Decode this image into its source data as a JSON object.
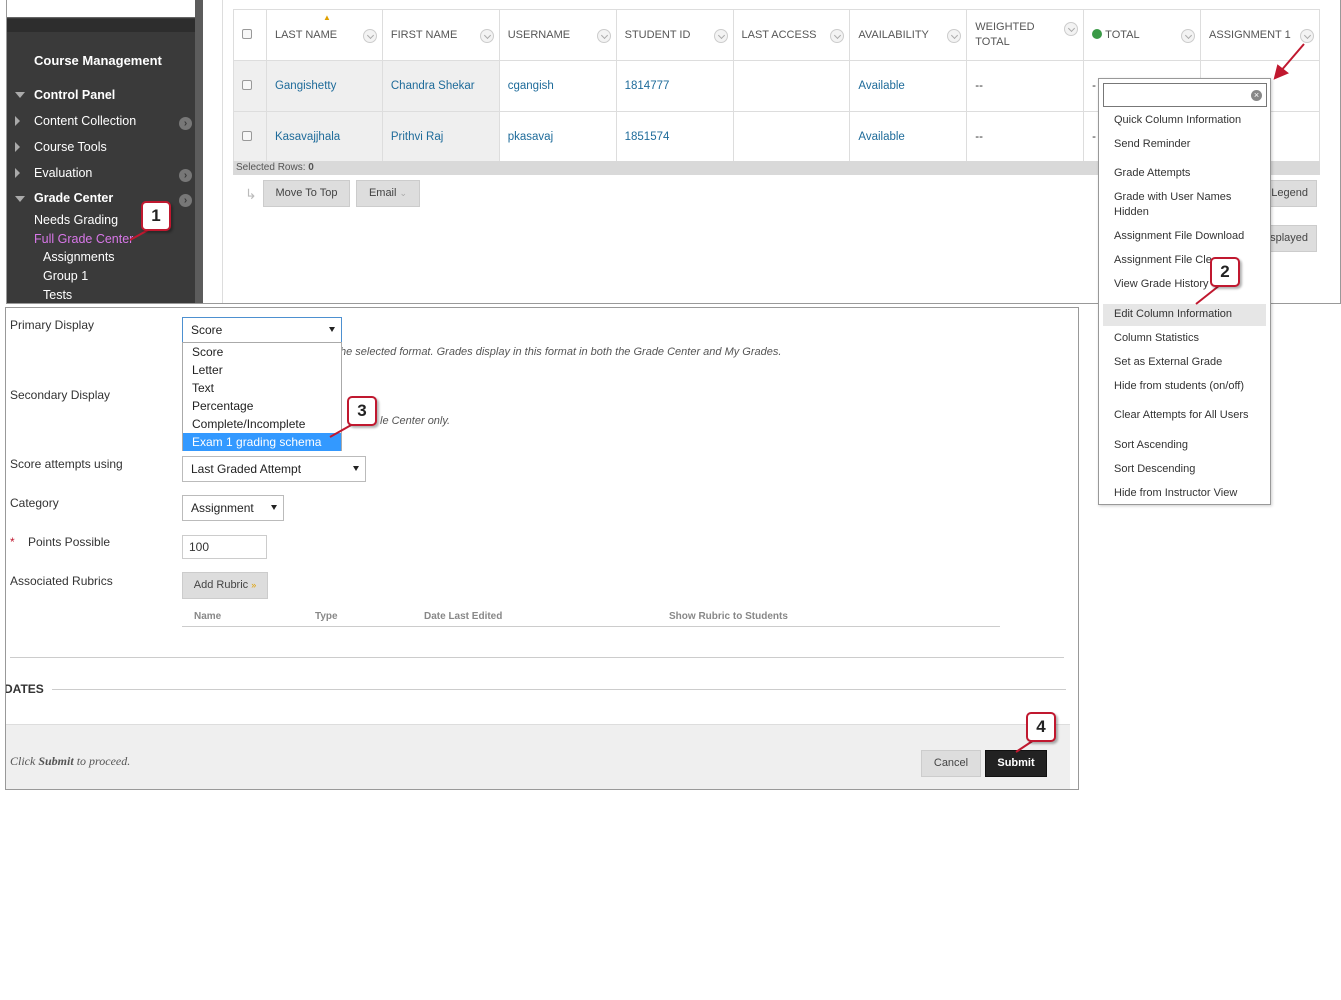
{
  "sidebar": {
    "title": "Course Management",
    "control_panel": "Control Panel",
    "items": [
      "Content Collection",
      "Course Tools",
      "Evaluation"
    ],
    "grade_center": "Grade Center",
    "needs_grading": "Needs Grading",
    "full_grade_center": "Full Grade Center",
    "subitems": [
      "Assignments",
      "Group 1",
      "Tests"
    ]
  },
  "grid": {
    "columns": [
      "LAST NAME",
      "FIRST NAME",
      "USERNAME",
      "STUDENT ID",
      "LAST ACCESS",
      "AVAILABILITY",
      "WEIGHTED TOTAL",
      "TOTAL",
      "ASSIGNMENT 1"
    ],
    "rows": [
      {
        "last": "Gangishetty",
        "first": "Chandra Shekar",
        "username": "cgangish",
        "id": "1814777",
        "access": "",
        "availability": "Available",
        "weighted": "--",
        "total": "-"
      },
      {
        "last": "Kasavajjhala",
        "first": "Prithvi Raj",
        "username": "pkasavaj",
        "id": "1851574",
        "access": "",
        "availability": "Available",
        "weighted": "--",
        "total": "-"
      }
    ],
    "selected_rows_label": "Selected Rows:",
    "selected_rows_count": "0",
    "move_to_top": "Move To Top",
    "email": "Email",
    "legend_partial": "Legend",
    "displayed_partial": "splayed"
  },
  "context_menu": {
    "items": [
      "Quick Column Information",
      "Send Reminder",
      "Grade Attempts",
      "Grade with User Names",
      "Hidden",
      "Assignment File Download",
      "Assignment File Cle",
      "View Grade History",
      "Edit Column Information",
      "Column Statistics",
      "Set as External Grade",
      "Hide from students (on/off)",
      "Clear Attempts for All Users",
      "Sort Ascending",
      "Sort Descending",
      "Hide from Instructor View"
    ]
  },
  "form": {
    "primary_display_label": "Primary Display",
    "primary_display_value": "Score",
    "primary_help": "he selected format. Grades display in this format in both the Grade Center and My Grades.",
    "options": [
      "Score",
      "Letter",
      "Text",
      "Percentage",
      "Complete/Incomplete",
      "Exam 1 grading schema"
    ],
    "secondary_display_label": "Secondary Display",
    "secondary_help": "le Center only.",
    "score_attempts_label": "Score attempts using",
    "score_attempts_value": "Last Graded Attempt",
    "category_label": "Category",
    "category_value": "Assignment",
    "points_label": "Points Possible",
    "points_required": "*",
    "points_value": "100",
    "rubrics_label": "Associated Rubrics",
    "add_rubric": "Add Rubric",
    "rubric_headers": [
      "Name",
      "Type",
      "Date Last Edited",
      "Show Rubric to Students"
    ],
    "dates_heading": "DATES",
    "footer_pre": "Click ",
    "footer_bold": "Submit",
    "footer_post": " to proceed.",
    "cancel": "Cancel",
    "submit": "Submit"
  },
  "callouts": [
    "1",
    "2",
    "3",
    "4"
  ],
  "colors": {
    "callout_border": "#c0182f",
    "link": "#1e6b9a",
    "active_link": "#d877e8",
    "selected_option": "#3399ff"
  }
}
